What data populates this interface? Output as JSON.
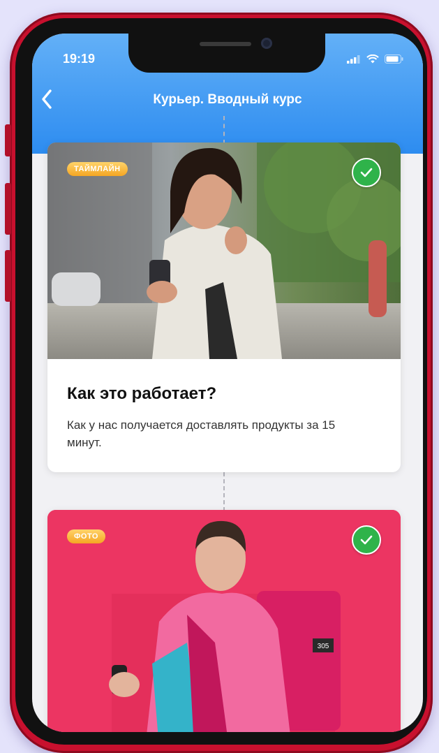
{
  "status_bar": {
    "time": "19:19"
  },
  "nav": {
    "title": "Курьер. Вводный курс",
    "back_icon": "chevron-left-icon"
  },
  "cards": [
    {
      "badge": "ТАЙМЛАЙН",
      "completed": true,
      "title": "Как это работает?",
      "description": "Как у нас получается доставлять продукты за 15 минут."
    },
    {
      "badge": "ФОТО",
      "completed": true,
      "image_text": "305"
    }
  ],
  "colors": {
    "header": "#2d8cf0",
    "phone_frame": "#c8102e",
    "badge": "#f5a623",
    "check": "#2fb34a",
    "card2_bg": "#ec3562"
  }
}
